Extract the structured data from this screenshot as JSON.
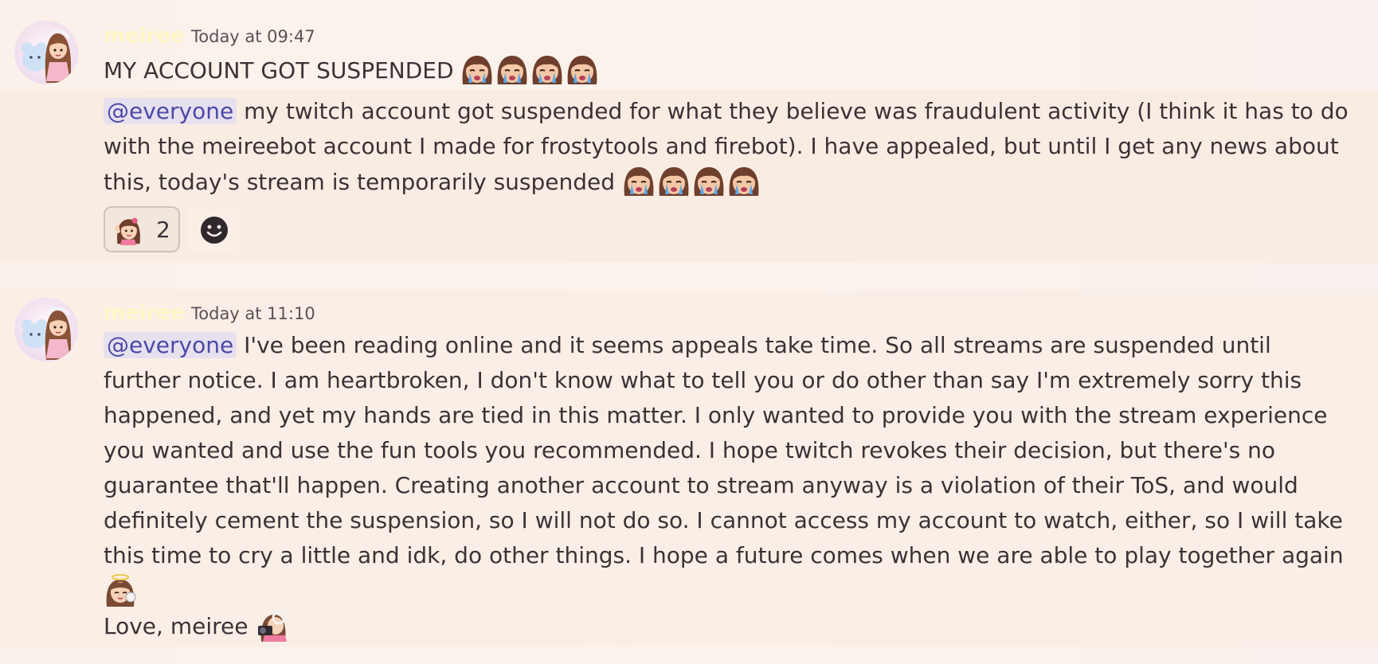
{
  "messages": [
    {
      "author": "meiree",
      "timestamp": "Today at 09:47",
      "line1": "MY ACCOUNT GOT SUSPENDED",
      "mention": "@everyone",
      "line2": "my twitch account got suspended for what they believe was fraudulent activity (I think it has to do",
      "line3": "with the meireebot account I made for frostytools and firebot). I have appealed, but until I get any news about",
      "line4": "this, today's stream is temporarily suspended",
      "reaction": {
        "emoji": "meiree-wave-emoji",
        "count": "2"
      },
      "add_reaction_icon": "smiley-icon"
    },
    {
      "author": "meiree",
      "timestamp": "Today at 11:10",
      "mention": "@everyone",
      "lines": [
        "I've been reading online and it seems appeals take time. So all streams are suspended until",
        "further notice. I am heartbroken, I don't know what to tell you or do other than say I'm extremely sorry this",
        "happened, and yet my hands are tied in this matter. I only wanted to provide you with the stream experience",
        "you wanted and use the fun tools you recommended. I hope twitch revokes their decision, but there's no",
        "guarantee that'll happen. Creating another account to stream anyway is a violation of their ToS, and would",
        "definitely cement the suspension, so I will not do so. I cannot access my account to watch, either, so I will take",
        "this time to cry a little and idk, do other things. I hope a future comes when we are able to play together again"
      ],
      "signoff": "Love, meiree"
    }
  ],
  "colors": {
    "username": "#fff6c7",
    "mention_bg": "#e7e0ee",
    "mention_text": "#4b4aa8",
    "text": "#3b3236"
  },
  "emoji_names": [
    "crying-girl-emoji",
    "meiree-wave-emoji",
    "angel-girl-emoji",
    "camera-girl-emoji"
  ]
}
